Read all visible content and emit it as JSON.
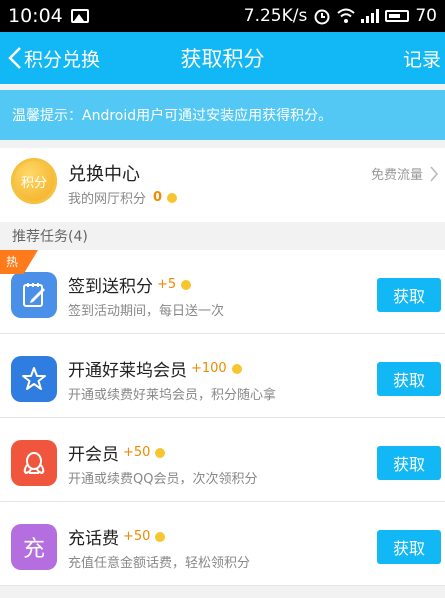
{
  "status_bar": {
    "time": "10:04",
    "right_text": "7.25K/s",
    "right_percent": "70"
  },
  "nav": {
    "back_label": "积分兑换",
    "title": "获取积分",
    "right_label": "记录"
  },
  "tip": "温馨提示：Android用户可通过安装应用获得积分。",
  "exchange": {
    "coin_label": "积分",
    "title": "兑换中心",
    "subtitle": "我的网厅积分",
    "points": "0",
    "right_text": "免费流量"
  },
  "section_title": "推荐任务(4)",
  "hot_label": "热",
  "tasks": [
    {
      "title": "签到送积分",
      "points": "+5",
      "desc": "签到活动期间，每日送一次",
      "button": "获取",
      "icon": "signin-note-icon",
      "color": "#4a90e8"
    },
    {
      "title": "开通好莱坞会员",
      "points": "+100",
      "desc": "开通或续费好莱坞会员，积分随心拿",
      "button": "获取",
      "icon": "star-icon",
      "color": "#2f7de0"
    },
    {
      "title": "开会员",
      "points": "+50",
      "desc": "开通或续费QQ会员，次次领积分",
      "button": "获取",
      "icon": "qq-penguin-icon",
      "color": "#f0553e"
    },
    {
      "title": "充话费",
      "points": "+50",
      "desc": "充值任意金额话费，轻松领积分",
      "button": "获取",
      "icon_text": "充",
      "icon": "recharge-icon",
      "color": "#b56ee0"
    }
  ]
}
